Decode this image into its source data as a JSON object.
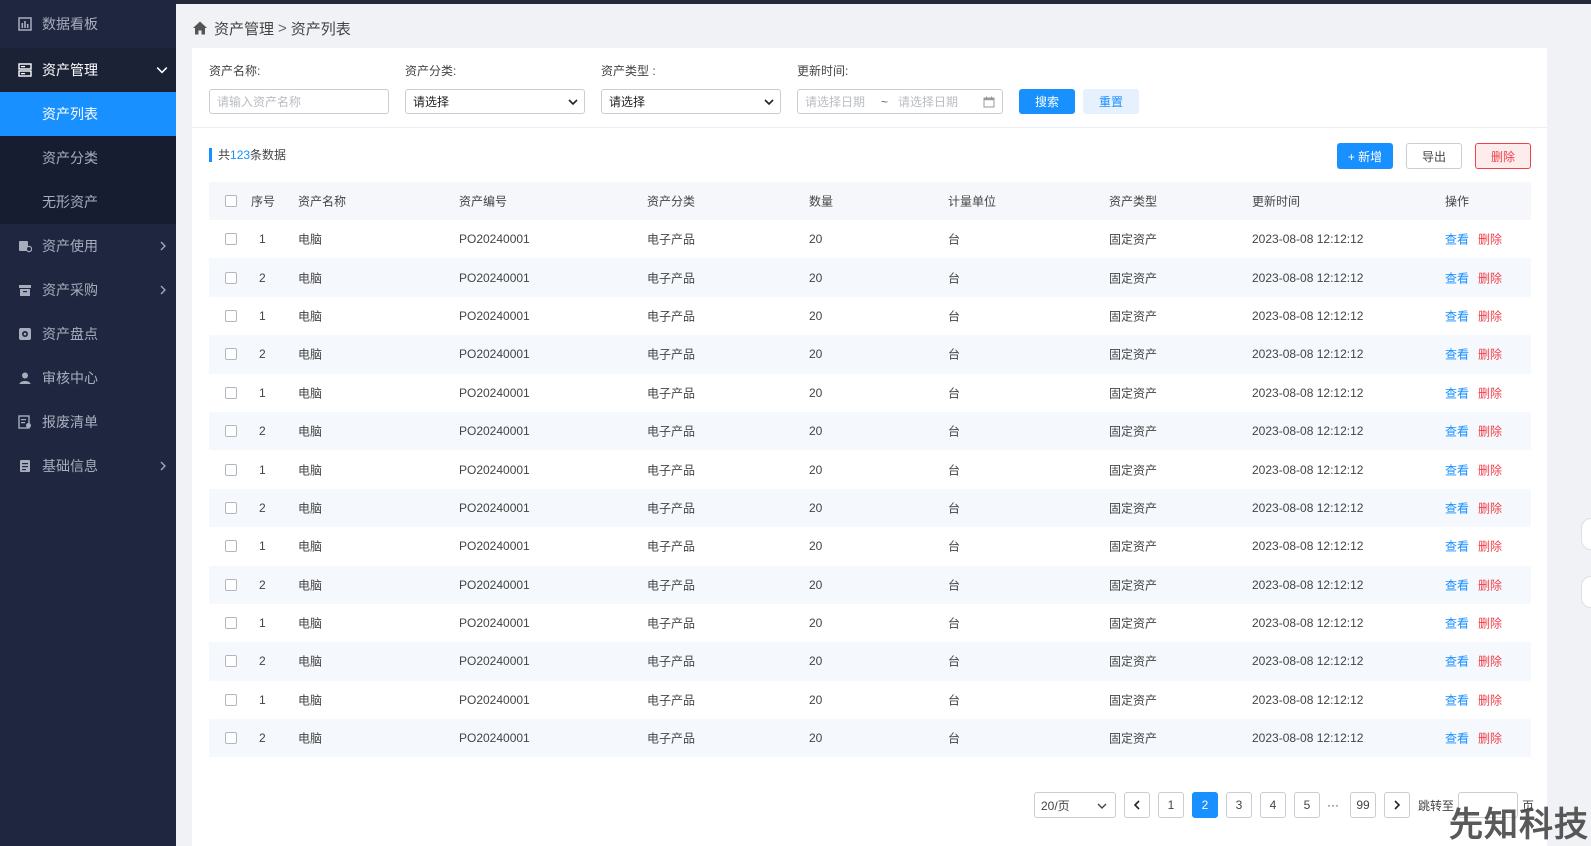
{
  "sidebar": {
    "items": [
      {
        "label": "数据看板",
        "icon": "dashboard-icon"
      },
      {
        "label": "资产管理",
        "icon": "server-icon"
      },
      {
        "label": "资产使用",
        "icon": "asset-use-icon"
      },
      {
        "label": "资产采购",
        "icon": "box-icon"
      },
      {
        "label": "资产盘点",
        "icon": "inventory-icon"
      },
      {
        "label": "审核中心",
        "icon": "user-icon"
      },
      {
        "label": "报废清单",
        "icon": "scrap-list-icon"
      },
      {
        "label": "基础信息",
        "icon": "document-icon"
      }
    ],
    "sub_items": [
      {
        "label": "资产列表"
      },
      {
        "label": "资产分类"
      },
      {
        "label": "无形资产"
      }
    ]
  },
  "breadcrumb": {
    "level1": "资产管理",
    "sep": ">",
    "level2": "资产列表"
  },
  "filter": {
    "name_label": "资产名称:",
    "name_placeholder": "请输入资产名称",
    "category_label": "资产分类:",
    "category_value": "请选择",
    "type_label": "资产类型 :",
    "type_value": "请选择",
    "time_label": "更新时间:",
    "date_start_placeholder": "请选择日期",
    "date_sep": "~",
    "date_end_placeholder": "请选择日期",
    "search_label": "搜索",
    "reset_label": "重置"
  },
  "toolbar": {
    "count_prefix": "共",
    "count": "123",
    "count_suffix": "条数据",
    "add_label": "+ 新增",
    "export_label": "导出",
    "delete_label": "删除"
  },
  "table": {
    "headers": [
      "序号",
      "资产名称",
      "资产编号",
      "资产分类",
      "数量",
      "计量单位",
      "资产类型",
      "更新时间",
      "操作"
    ],
    "action_view": "查看",
    "action_delete": "删除",
    "rows": [
      [
        "1",
        "电脑",
        "PO20240001",
        "电子产品",
        "20",
        "台",
        "固定资产",
        "2023-08-08 12:12:12"
      ],
      [
        "2",
        "电脑",
        "PO20240001",
        "电子产品",
        "20",
        "台",
        "固定资产",
        "2023-08-08 12:12:12"
      ],
      [
        "1",
        "电脑",
        "PO20240001",
        "电子产品",
        "20",
        "台",
        "固定资产",
        "2023-08-08 12:12:12"
      ],
      [
        "2",
        "电脑",
        "PO20240001",
        "电子产品",
        "20",
        "台",
        "固定资产",
        "2023-08-08 12:12:12"
      ],
      [
        "1",
        "电脑",
        "PO20240001",
        "电子产品",
        "20",
        "台",
        "固定资产",
        "2023-08-08 12:12:12"
      ],
      [
        "2",
        "电脑",
        "PO20240001",
        "电子产品",
        "20",
        "台",
        "固定资产",
        "2023-08-08 12:12:12"
      ],
      [
        "1",
        "电脑",
        "PO20240001",
        "电子产品",
        "20",
        "台",
        "固定资产",
        "2023-08-08 12:12:12"
      ],
      [
        "2",
        "电脑",
        "PO20240001",
        "电子产品",
        "20",
        "台",
        "固定资产",
        "2023-08-08 12:12:12"
      ],
      [
        "1",
        "电脑",
        "PO20240001",
        "电子产品",
        "20",
        "台",
        "固定资产",
        "2023-08-08 12:12:12"
      ],
      [
        "2",
        "电脑",
        "PO20240001",
        "电子产品",
        "20",
        "台",
        "固定资产",
        "2023-08-08 12:12:12"
      ],
      [
        "1",
        "电脑",
        "PO20240001",
        "电子产品",
        "20",
        "台",
        "固定资产",
        "2023-08-08 12:12:12"
      ],
      [
        "2",
        "电脑",
        "PO20240001",
        "电子产品",
        "20",
        "台",
        "固定资产",
        "2023-08-08 12:12:12"
      ],
      [
        "1",
        "电脑",
        "PO20240001",
        "电子产品",
        "20",
        "台",
        "固定资产",
        "2023-08-08 12:12:12"
      ],
      [
        "2",
        "电脑",
        "PO20240001",
        "电子产品",
        "20",
        "台",
        "固定资产",
        "2023-08-08 12:12:12"
      ]
    ]
  },
  "pagination": {
    "page_size": "20/页",
    "pages": [
      "1",
      "2",
      "3",
      "4",
      "5"
    ],
    "current": "2",
    "ellipsis": "···",
    "last": "99",
    "jump_prefix": "跳转至",
    "jump_suffix": "页"
  },
  "watermark": "先知科技",
  "colors": {
    "primary": "#1890ff",
    "danger": "#f0414b",
    "sidebar": "#1f2740"
  }
}
